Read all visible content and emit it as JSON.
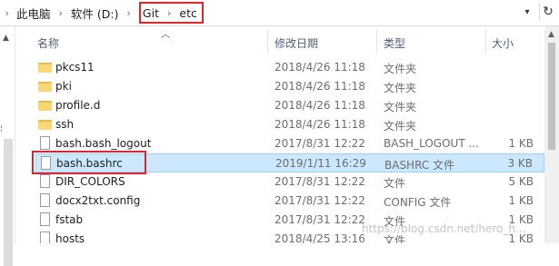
{
  "breadcrumb": {
    "items": [
      "此电脑",
      "软件 (D:)",
      "Git",
      "etc"
    ]
  },
  "columns": {
    "name": "名称",
    "modified": "修改日期",
    "type": "类型",
    "size": "大小"
  },
  "files": [
    {
      "name": "pkcs11",
      "modified": "2018/4/26 11:18",
      "type": "文件夹",
      "size": "",
      "icon": "folder-icon"
    },
    {
      "name": "pki",
      "modified": "2018/4/26 11:18",
      "type": "文件夹",
      "size": "",
      "icon": "folder-icon"
    },
    {
      "name": "profile.d",
      "modified": "2018/4/26 11:18",
      "type": "文件夹",
      "size": "",
      "icon": "folder-icon"
    },
    {
      "name": "ssh",
      "modified": "2018/4/26 11:18",
      "type": "文件夹",
      "size": "",
      "icon": "folder-icon"
    },
    {
      "name": "bash.bash_logout",
      "modified": "2017/8/31 12:22",
      "type": "BASH_LOGOUT ...",
      "size": "1 KB",
      "icon": "file-icon"
    },
    {
      "name": "bash.bashrc",
      "modified": "2019/1/11 16:29",
      "type": "BASHRC 文件",
      "size": "3 KB",
      "icon": "file-icon",
      "selected": true
    },
    {
      "name": "DIR_COLORS",
      "modified": "2017/8/31 12:22",
      "type": "文件",
      "size": "5 KB",
      "icon": "file-icon"
    },
    {
      "name": "docx2txt.config",
      "modified": "2017/8/31 12:22",
      "type": "CONFIG 文件",
      "size": "1 KB",
      "icon": "file-icon"
    },
    {
      "name": "fstab",
      "modified": "2017/8/31 12:22",
      "type": "文件",
      "size": "1 KB",
      "icon": "file-icon"
    },
    {
      "name": "hosts",
      "modified": "2018/4/25 13:16",
      "type": "文件",
      "size": "1 KB",
      "icon": "file-icon"
    }
  ],
  "watermark": "https://blog.csdn.net/hero_h..."
}
